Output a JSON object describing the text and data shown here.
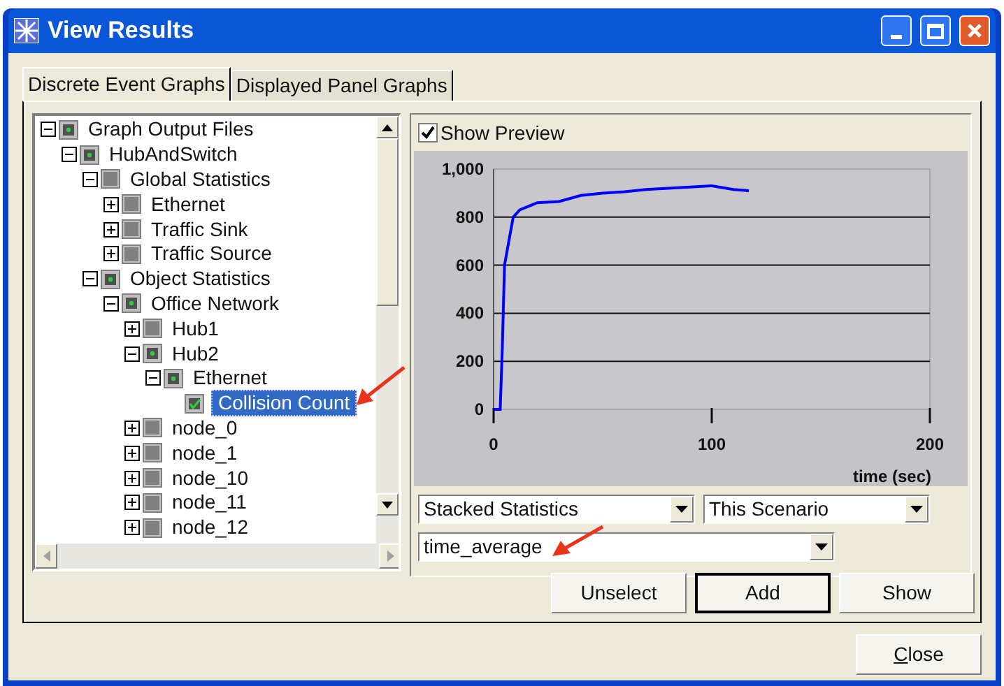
{
  "window": {
    "title": "View Results"
  },
  "tabs": [
    {
      "label": "Discrete Event Graphs",
      "selected": true
    },
    {
      "label": "Displayed Panel Graphs",
      "selected": false
    }
  ],
  "tree": [
    {
      "label": "Graph Output Files",
      "checked": false,
      "partial": true,
      "expanded": true,
      "selected": false,
      "children": [
        {
          "label": "HubAndSwitch",
          "checked": false,
          "partial": true,
          "expanded": true,
          "selected": false,
          "children": [
            {
              "label": "Global Statistics",
              "checked": false,
              "partial": false,
              "expanded": true,
              "selected": false,
              "children": [
                {
                  "label": "Ethernet",
                  "checked": false,
                  "partial": false,
                  "expanded": false,
                  "selected": false
                },
                {
                  "label": "Traffic Sink",
                  "checked": false,
                  "partial": false,
                  "expanded": false,
                  "selected": false
                },
                {
                  "label": "Traffic Source",
                  "checked": false,
                  "partial": false,
                  "expanded": false,
                  "selected": false
                }
              ]
            },
            {
              "label": "Object Statistics",
              "checked": false,
              "partial": true,
              "expanded": true,
              "selected": false,
              "children": [
                {
                  "label": "Office Network",
                  "checked": false,
                  "partial": true,
                  "expanded": true,
                  "selected": false,
                  "children": [
                    {
                      "label": "Hub1",
                      "checked": false,
                      "partial": false,
                      "expanded": false,
                      "selected": false
                    },
                    {
                      "label": "Hub2",
                      "checked": false,
                      "partial": true,
                      "expanded": true,
                      "selected": false,
                      "children": [
                        {
                          "label": "Ethernet",
                          "checked": false,
                          "partial": true,
                          "expanded": true,
                          "selected": false,
                          "children": [
                            {
                              "label": "Collision Count",
                              "checked": true,
                              "selected": true
                            }
                          ]
                        }
                      ]
                    },
                    {
                      "label": "node_0",
                      "checked": false,
                      "partial": false,
                      "expanded": false,
                      "selected": false
                    },
                    {
                      "label": "node_1",
                      "checked": false,
                      "partial": false,
                      "expanded": false,
                      "selected": false
                    },
                    {
                      "label": "node_10",
                      "checked": false,
                      "partial": false,
                      "expanded": false,
                      "selected": false
                    },
                    {
                      "label": "node_11",
                      "checked": false,
                      "partial": false,
                      "expanded": false,
                      "selected": false
                    },
                    {
                      "label": "node_12",
                      "checked": false,
                      "partial": false,
                      "expanded": false,
                      "selected": false
                    }
                  ]
                }
              ]
            }
          ]
        }
      ]
    }
  ],
  "preview": {
    "label": "Show Preview",
    "checked": true
  },
  "chart_data": {
    "type": "line",
    "grid": true,
    "xlabel": "time (sec)",
    "xlim": [
      0,
      200
    ],
    "ylim": [
      0,
      1000
    ],
    "xticks": [
      0,
      100,
      200
    ],
    "yticks": [
      0,
      200,
      400,
      600,
      800,
      {
        "value": 1000,
        "label": "1,000"
      }
    ],
    "x": [
      0,
      3,
      4,
      5,
      7,
      9,
      12,
      20,
      30,
      40,
      50,
      60,
      70,
      80,
      90,
      100,
      110,
      117
    ],
    "series": [
      {
        "color": "#0000ff",
        "values": [
          0,
          0,
          250,
          600,
          700,
          800,
          830,
          860,
          865,
          890,
          900,
          905,
          915,
          920,
          925,
          930,
          915,
          910
        ]
      }
    ]
  },
  "dropdowns": [
    {
      "value": "Stacked Statistics"
    },
    {
      "value": "This Scenario"
    },
    {
      "value": "time_average"
    }
  ],
  "buttons": [
    {
      "label": "Unselect",
      "default": false
    },
    {
      "label": "Add",
      "default": true
    },
    {
      "label": "Show",
      "default": false
    }
  ],
  "close_button": {
    "label": "Close"
  }
}
